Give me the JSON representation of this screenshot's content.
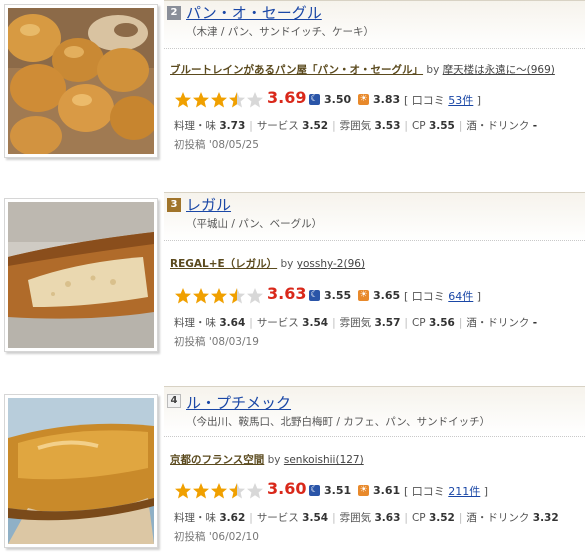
{
  "entries": [
    {
      "rank": "2",
      "name": "パン・オ・セーグル",
      "sub": "（木津 / パン、サンドイッチ、ケーキ）",
      "review_title": "ブルートレインがあるパン屋「パン・オ・セーグル」",
      "by": "by",
      "reviewer": "摩天楼は永遠に～(969)",
      "star_rating": 3.5,
      "score": "3.69",
      "night": "3.50",
      "day": "3.83",
      "kuchikomi_label": "口コミ",
      "kuchikomi_count": "53件",
      "scores": {
        "taste_label": "料理・味",
        "taste": "3.73",
        "service_label": "サービス",
        "service": "3.52",
        "atmos_label": "雰囲気",
        "atmos": "3.53",
        "cp_label": "CP",
        "cp": "3.55",
        "drink_label": "酒・ドリンク",
        "drink": "-"
      },
      "posted": "初投稿 '08/05/25"
    },
    {
      "rank": "3",
      "name": "レガル",
      "sub": "（平城山 / パン、ベーグル）",
      "review_title": "REGAL+E（レガル）",
      "by": "by",
      "reviewer": "yosshy-2(96)",
      "star_rating": 3.5,
      "score": "3.63",
      "night": "3.55",
      "day": "3.65",
      "kuchikomi_label": "口コミ",
      "kuchikomi_count": "64件",
      "scores": {
        "taste_label": "料理・味",
        "taste": "3.64",
        "service_label": "サービス",
        "service": "3.54",
        "atmos_label": "雰囲気",
        "atmos": "3.57",
        "cp_label": "CP",
        "cp": "3.56",
        "drink_label": "酒・ドリンク",
        "drink": "-"
      },
      "posted": "初投稿 '08/03/19"
    },
    {
      "rank": "4",
      "name": "ル・プチメック",
      "sub": "（今出川、鞍馬口、北野白梅町 / カフェ、パン、サンドイッチ）",
      "review_title": "京都のフランス空間",
      "by": "by",
      "reviewer": "senkoishii(127)",
      "star_rating": 3.5,
      "score": "3.60",
      "night": "3.51",
      "day": "3.61",
      "kuchikomi_label": "口コミ",
      "kuchikomi_count": "211件",
      "scores": {
        "taste_label": "料理・味",
        "taste": "3.62",
        "service_label": "サービス",
        "service": "3.54",
        "atmos_label": "雰囲気",
        "atmos": "3.63",
        "cp_label": "CP",
        "cp": "3.52",
        "drink_label": "酒・ドリンク",
        "drink": "3.32"
      },
      "posted": "初投稿 '06/02/10"
    }
  ],
  "colors": {
    "link": "#1a47a6",
    "score": "#d9281a",
    "star": "#f0a000",
    "night_icon": "#2a55a8",
    "day_icon": "#e8892b"
  }
}
